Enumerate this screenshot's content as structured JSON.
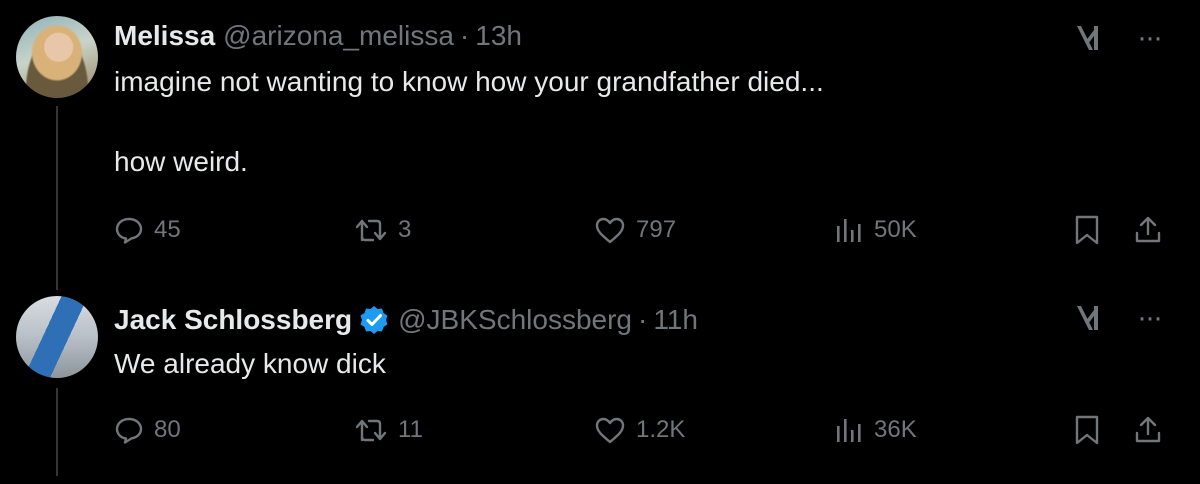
{
  "tweets": [
    {
      "author": {
        "name": "Melissa",
        "handle": "@arizona_melissa",
        "verified": false
      },
      "separator": "·",
      "time": "13h",
      "text": "imagine not wanting to know how your grandfather died...\n\nhow weird.",
      "stats": {
        "replies": "45",
        "reposts": "3",
        "likes": "797",
        "views": "50K"
      }
    },
    {
      "author": {
        "name": "Jack Schlossberg",
        "handle": "@JBKSchlossberg",
        "verified": true
      },
      "separator": "·",
      "time": "11h",
      "text": "We already know dick",
      "stats": {
        "replies": "80",
        "reposts": "11",
        "likes": "1.2K",
        "views": "36K"
      }
    }
  ],
  "colors": {
    "background": "#000000",
    "text_primary": "#e7e9ea",
    "text_secondary": "#71767b",
    "verified_badge": "#1d9bf0",
    "thread_line": "#333639"
  },
  "icons": {
    "reply": "comment-bubble-icon",
    "repost": "repost-arrows-icon",
    "like": "heart-icon",
    "views": "bar-chart-icon",
    "bookmark": "bookmark-icon",
    "share": "share-upload-icon",
    "grok": "grok-icon",
    "more": "more-dots-icon",
    "verified": "verified-badge-icon"
  },
  "more_label": "···"
}
